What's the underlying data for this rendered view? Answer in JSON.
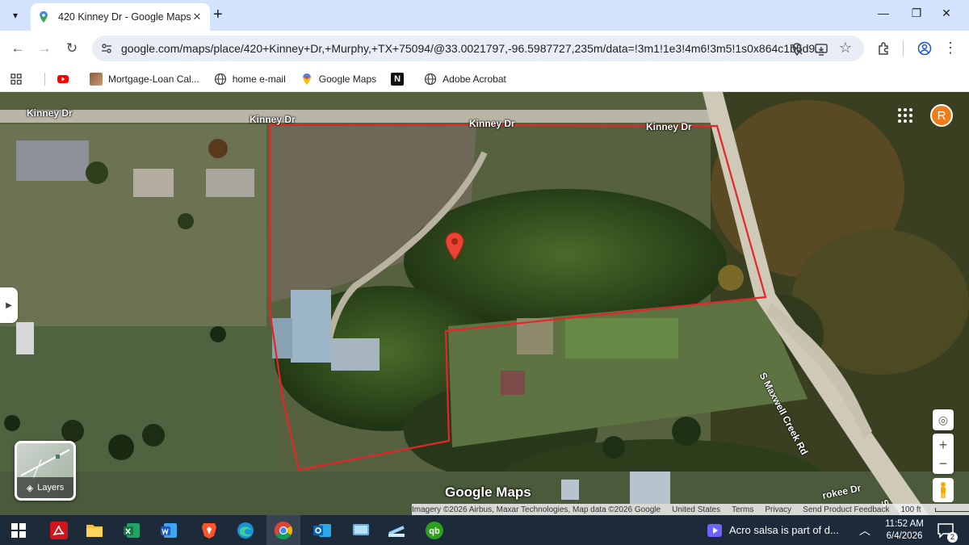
{
  "browser": {
    "tab": {
      "title": "420 Kinney Dr - Google Maps",
      "favicon": "google-maps-pin-icon"
    },
    "url": "google.com/maps/place/420+Kinney+Dr,+Murphy,+TX+75094/@33.0021797,-96.5987727,235m/data=!3m1!1e3!4m6!3m5!1s0x864c1b5d9...",
    "bookmarks": [
      {
        "label": "",
        "icon": "youtube-icon"
      },
      {
        "label": "Mortgage-Loan Cal...",
        "icon": "mortgage-thumbnail-icon"
      },
      {
        "label": "home e-mail",
        "icon": "globe-icon"
      },
      {
        "label": "Google Maps",
        "icon": "google-maps-pin-icon"
      },
      {
        "label": "",
        "icon": "notion-icon"
      },
      {
        "label": "Adobe Acrobat",
        "icon": "globe-icon"
      }
    ]
  },
  "map": {
    "road_labels": [
      "Kinney Dr",
      "Kinney Dr",
      "Kinney Dr",
      "Kinney Dr",
      "S Maxwell Creek Rd",
      "rokee Dr",
      "S"
    ],
    "account_initial": "R",
    "layers_label": "Layers",
    "logo": "Google Maps",
    "attribution": {
      "imagery": "Imagery ©2026 Airbus, Maxar Technologies, Map data ©2026 Google",
      "country": "United States",
      "terms": "Terms",
      "privacy": "Privacy",
      "feedback": "Send Product Feedback",
      "scale": "100 ft"
    },
    "colors": {
      "parcel_outline": "#e8242a",
      "pin": "#ea4335"
    }
  },
  "taskbar": {
    "notification": "Acro salsa is part of d...",
    "time": "11:52 AM",
    "date": "6/4/2026",
    "notification_count": "2"
  }
}
